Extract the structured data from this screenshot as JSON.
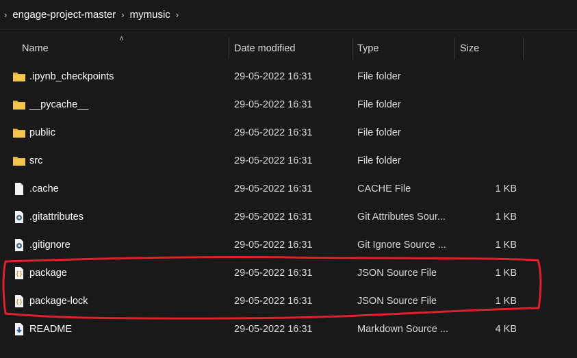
{
  "breadcrumb": {
    "items": [
      "engage-project-master",
      "mymusic"
    ]
  },
  "columns": {
    "name": "Name",
    "date": "Date modified",
    "type": "Type",
    "size": "Size"
  },
  "files": [
    {
      "name": ".ipynb_checkpoints",
      "date": "29-05-2022 16:31",
      "type": "File folder",
      "size": "",
      "icon": "folder-icon"
    },
    {
      "name": "__pycache__",
      "date": "29-05-2022 16:31",
      "type": "File folder",
      "size": "",
      "icon": "folder-icon"
    },
    {
      "name": "public",
      "date": "29-05-2022 16:31",
      "type": "File folder",
      "size": "",
      "icon": "folder-icon"
    },
    {
      "name": "src",
      "date": "29-05-2022 16:31",
      "type": "File folder",
      "size": "",
      "icon": "folder-icon"
    },
    {
      "name": ".cache",
      "date": "29-05-2022 16:31",
      "type": "CACHE File",
      "size": "1 KB",
      "icon": "blank-file-icon"
    },
    {
      "name": ".gitattributes",
      "date": "29-05-2022 16:31",
      "type": "Git Attributes Sour...",
      "size": "1 KB",
      "icon": "settings-file-icon"
    },
    {
      "name": ".gitignore",
      "date": "29-05-2022 16:31",
      "type": "Git Ignore Source ...",
      "size": "1 KB",
      "icon": "settings-file-icon"
    },
    {
      "name": "package",
      "date": "29-05-2022 16:31",
      "type": "JSON Source File",
      "size": "1 KB",
      "icon": "json-file-icon"
    },
    {
      "name": "package-lock",
      "date": "29-05-2022 16:31",
      "type": "JSON Source File",
      "size": "1 KB",
      "icon": "json-file-icon"
    },
    {
      "name": "README",
      "date": "29-05-2022 16:31",
      "type": "Markdown Source ...",
      "size": "4 KB",
      "icon": "markdown-file-icon"
    }
  ],
  "colors": {
    "background": "#191919",
    "folder": "#f5c64e",
    "annotation": "#e0202a"
  }
}
